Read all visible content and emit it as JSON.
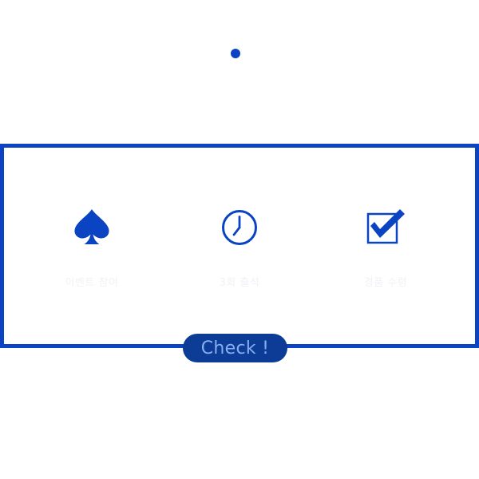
{
  "steps": [
    {
      "icon": "spade-icon",
      "label": "이벤트 참여"
    },
    {
      "icon": "clock-icon",
      "label": "3회 출석"
    },
    {
      "icon": "checkbox-icon",
      "label": "경품 수령"
    }
  ],
  "badge": {
    "label": "Check !"
  },
  "colors": {
    "accent": "#0a44c2",
    "badge_bg": "#0d3c97",
    "badge_text": "#86aef0",
    "faint_label": "#f1f2f7"
  }
}
